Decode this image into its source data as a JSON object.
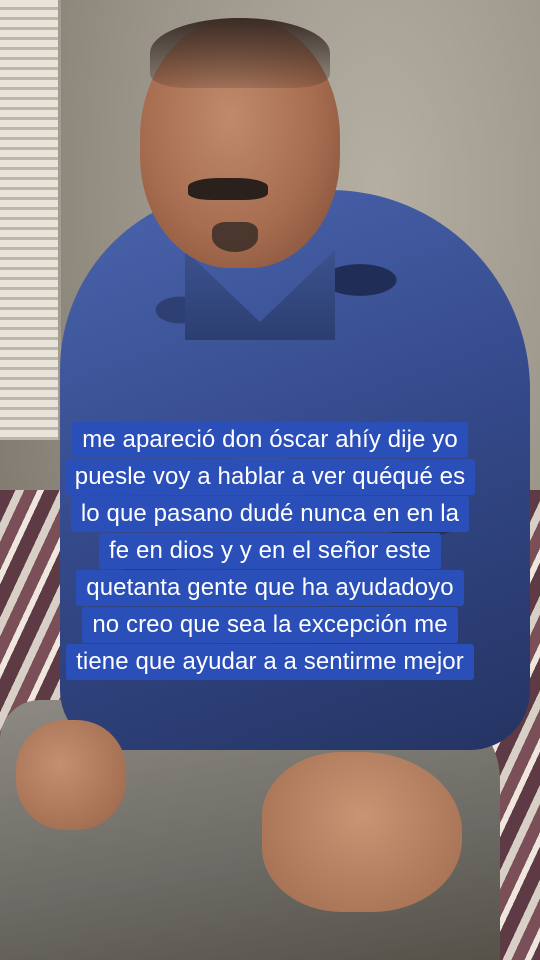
{
  "captions": {
    "lines": [
      "me apareció don óscar ahíy dije yo",
      "puesle voy a hablar a ver quéqué es",
      "lo que pasano dudé nunca en en la",
      "fe en dios y y en el señor este",
      "quetanta gente que ha ayudadoyo",
      "no creo que sea la excepción me",
      "tiene que ayudar a a sentirme mejor"
    ]
  },
  "colors": {
    "caption_background": "#2b4fb8",
    "caption_text": "#ffffff"
  }
}
